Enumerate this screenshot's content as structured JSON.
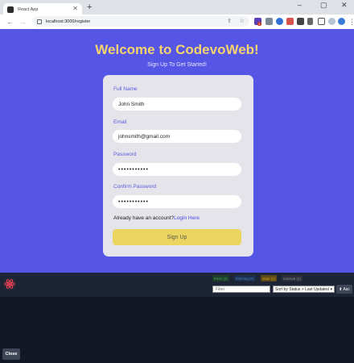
{
  "browser": {
    "tab_title": "React App",
    "tab_close": "✕",
    "new_tab": "+",
    "url": "localhost:3000/register",
    "window_controls": {
      "minimize": "–",
      "maximize": "▢",
      "close": "✕"
    },
    "nav": {
      "back": "←",
      "forward": "→",
      "reload": "↻"
    },
    "share_icon": "⇪",
    "star_icon": "☆",
    "menu_icon": "⋮",
    "extension_badge": "1"
  },
  "page": {
    "title": "Welcome to CodevoWeb!",
    "subtitle": "Sign Up To Get Started!",
    "form": {
      "full_name_label": "Full Name",
      "full_name_value": "John Smith",
      "email_label": "Email",
      "email_value": "johnsmith@gmail.com",
      "password_label": "Password",
      "password_value": "•••••••••••",
      "confirm_label": "Confirm Password",
      "confirm_value": "•••••••••••",
      "account_text": "Already have an account?",
      "login_link": "Login Here",
      "signup_button": "Sign Up"
    }
  },
  "devtools": {
    "pills": [
      "fresh (0)",
      "fetching (0)",
      "stale (1)",
      "inactive (1)"
    ],
    "filter_placeholder": "Filter",
    "sort_value": "Sort by Status > Last Updated",
    "asc_button": "⬆ Asc",
    "close_button": "Close"
  },
  "colors": {
    "page_bg": "#5555e6",
    "title": "#f5d46d",
    "button": "#ebd561",
    "label": "#5b5be0"
  }
}
